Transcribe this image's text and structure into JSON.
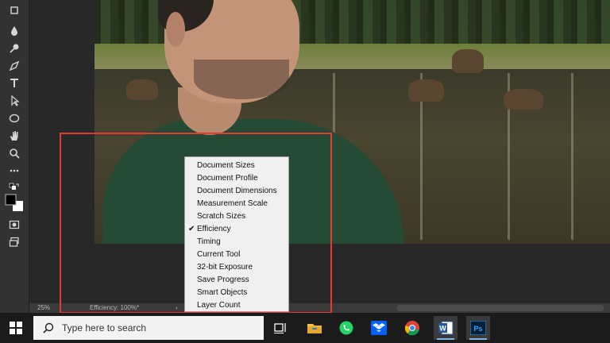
{
  "status_bar": {
    "zoom": "25%",
    "efficiency": "Efficiency: 100%*",
    "arrow": "›"
  },
  "popup_menu": {
    "items": [
      {
        "label": "Document Sizes",
        "checked": false
      },
      {
        "label": "Document Profile",
        "checked": false
      },
      {
        "label": "Document Dimensions",
        "checked": false
      },
      {
        "label": "Measurement Scale",
        "checked": false
      },
      {
        "label": "Scratch Sizes",
        "checked": false
      },
      {
        "label": "Efficiency",
        "checked": true
      },
      {
        "label": "Timing",
        "checked": false
      },
      {
        "label": "Current Tool",
        "checked": false
      },
      {
        "label": "32-bit Exposure",
        "checked": false
      },
      {
        "label": "Save Progress",
        "checked": false
      },
      {
        "label": "Smart Objects",
        "checked": false
      },
      {
        "label": "Layer Count",
        "checked": false
      }
    ],
    "check_glyph": "✔"
  },
  "taskbar": {
    "search_placeholder": "Type here to search",
    "apps": [
      "task-view",
      "file-explorer",
      "whatsapp",
      "dropbox",
      "chrome",
      "word",
      "photoshop"
    ],
    "photoshop_label": "Ps",
    "word_label": "W"
  },
  "colors": {
    "highlight": "#e53935",
    "accent": "#7fb7e8"
  }
}
